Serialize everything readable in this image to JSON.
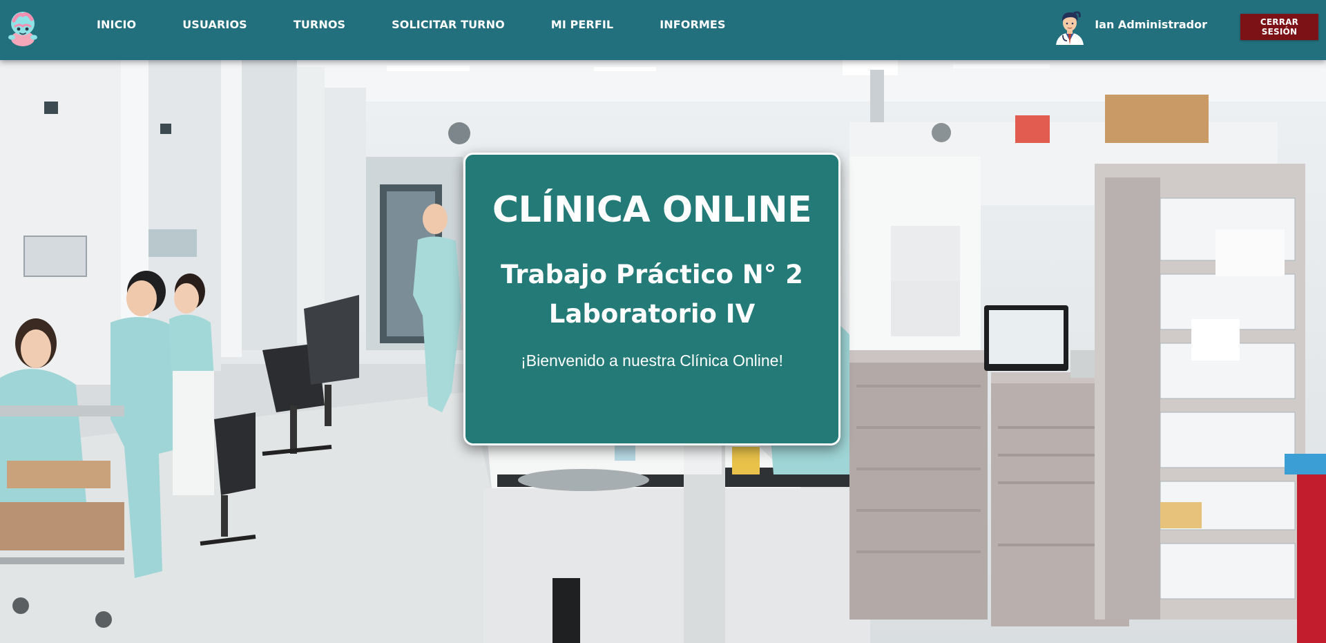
{
  "nav": {
    "logo_icon": "brain-mascot-icon",
    "links": [
      {
        "label": "INICIO"
      },
      {
        "label": "USUARIOS"
      },
      {
        "label": "TURNOS"
      },
      {
        "label": "SOLICITAR TURNO"
      },
      {
        "label": "MI PERFIL"
      },
      {
        "label": "INFORMES"
      }
    ],
    "user": {
      "name": "Ian Administrador",
      "avatar_icon": "doctor-avatar-icon"
    },
    "logout_label": "CERRAR SESIÓN"
  },
  "hero": {
    "background": "hospital-ward-photo",
    "title": "CLÍNICA ONLINE",
    "subtitle_line1": "Trabajo Práctico N° 2",
    "subtitle_line2": "Laboratorio IV",
    "message": "¡Bienvenido a nuestra Clínica Online!"
  },
  "colors": {
    "navbar": "#22707d",
    "card": "#237a77",
    "logout": "#7c1216"
  }
}
